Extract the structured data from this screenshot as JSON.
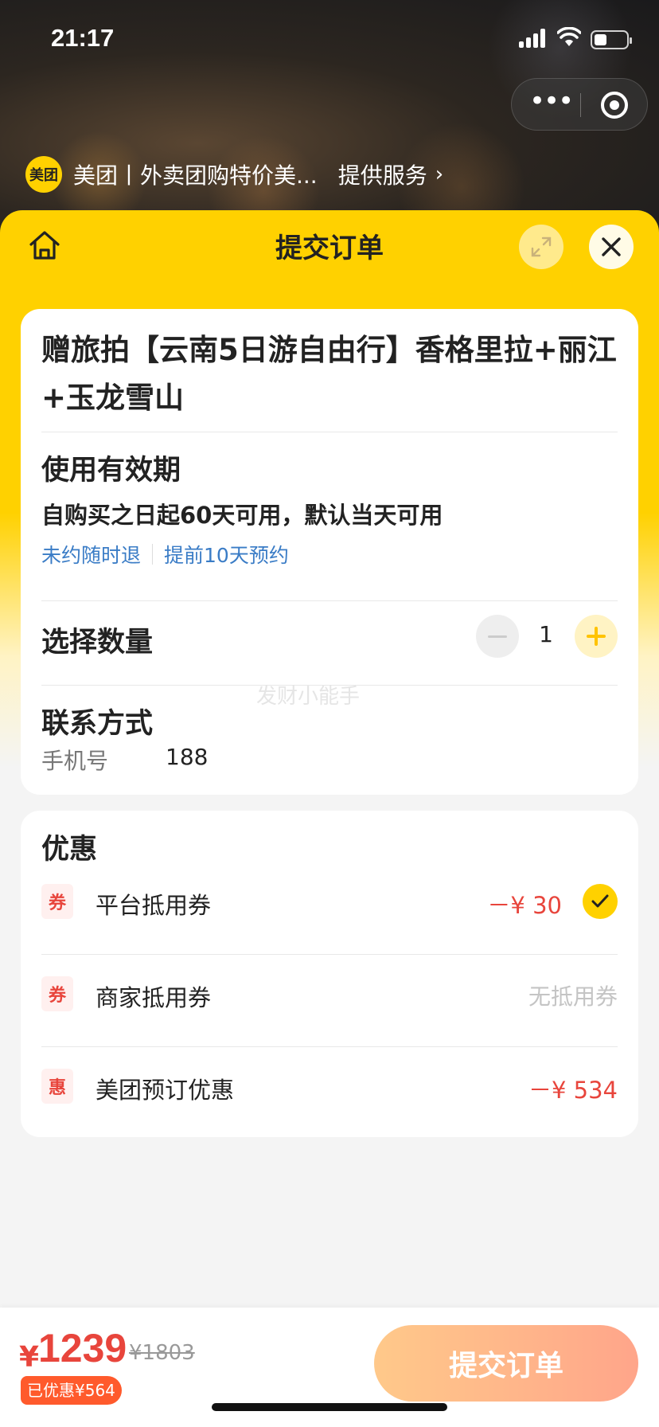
{
  "status_bar": {
    "time": "21:17"
  },
  "provider": {
    "logo_text": "美团",
    "name": "美团丨外卖团购特价美...",
    "action": "提供服务"
  },
  "sheet": {
    "title": "提交订单"
  },
  "product": {
    "title": "赠旅拍【云南5日游自由行】香格里拉+丽江+玉龙雪山"
  },
  "validity": {
    "heading": "使用有效期",
    "text": "自购买之日起60天可用，默认当天可用",
    "tags": [
      "未约随时退",
      "提前10天预约"
    ]
  },
  "quantity": {
    "heading": "选择数量",
    "value": "1"
  },
  "watermark": "发财小能手",
  "contact": {
    "heading": "联系方式",
    "phone_label": "手机号",
    "phone_value": "188"
  },
  "discounts": {
    "heading": "优惠",
    "items": [
      {
        "badge": "券",
        "name": "平台抵用券",
        "amount": "－¥ 30",
        "selected": true
      },
      {
        "badge": "券",
        "name": "商家抵用券",
        "amount": "无抵用券"
      },
      {
        "badge": "惠",
        "name": "美团预订优惠",
        "amount": "－¥ 534"
      }
    ]
  },
  "footer": {
    "currency": "¥",
    "price": "1239",
    "original_price": "¥1803",
    "saved": "已优惠¥564",
    "submit_label": "提交订单"
  },
  "colors": {
    "brand_yellow": "#ffd100",
    "price_red": "#e8453c",
    "link_blue": "#3a7cc6"
  }
}
